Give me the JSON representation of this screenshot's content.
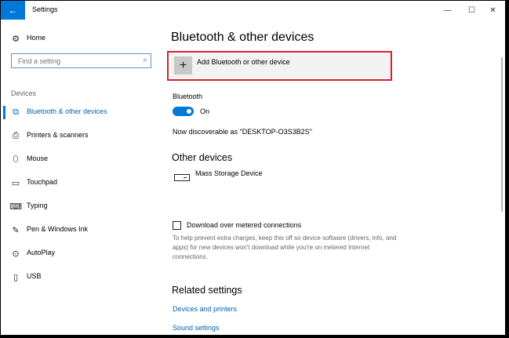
{
  "window": {
    "title": "Settings",
    "back_icon": "←",
    "minimize_icon": "—",
    "maximize_icon": "☐",
    "close_icon": "✕"
  },
  "sidebar": {
    "home": {
      "label": "Home",
      "icon": "⚙"
    },
    "search": {
      "placeholder": "Find a setting",
      "icon": "⌕"
    },
    "section_label": "Devices",
    "items": [
      {
        "label": "Bluetooth & other devices",
        "icon": "bluetooth-devices-icon",
        "glyph": "⧉",
        "active": true
      },
      {
        "label": "Printers & scanners",
        "icon": "printer-icon",
        "glyph": "⎙"
      },
      {
        "label": "Mouse",
        "icon": "mouse-icon",
        "glyph": "⬯"
      },
      {
        "label": "Touchpad",
        "icon": "touchpad-icon",
        "glyph": "▭"
      },
      {
        "label": "Typing",
        "icon": "keyboard-icon",
        "glyph": "⌨"
      },
      {
        "label": "Pen & Windows Ink",
        "icon": "pen-icon",
        "glyph": "✎"
      },
      {
        "label": "AutoPlay",
        "icon": "autoplay-icon",
        "glyph": "⊙"
      },
      {
        "label": "USB",
        "icon": "usb-icon",
        "glyph": "▯"
      }
    ]
  },
  "main": {
    "title": "Bluetooth & other devices",
    "add_button": {
      "label": "Add Bluetooth or other device",
      "icon": "+"
    },
    "bluetooth": {
      "label": "Bluetooth",
      "state": "On",
      "enabled": true
    },
    "discoverable": "Now discoverable as \"DESKTOP-O3S3B2S\"",
    "other_devices": {
      "heading": "Other devices",
      "devices": [
        {
          "name": "Mass Storage Device",
          "icon": "storage-device-icon"
        }
      ]
    },
    "metered": {
      "label": "Download over metered connections",
      "checked": false,
      "help": "To help prevent extra charges, keep this off so device software (drivers, info, and apps) for new devices won't download while you're on metered Internet connections."
    },
    "related": {
      "heading": "Related settings",
      "links": [
        "Devices and printers",
        "Sound settings"
      ]
    }
  },
  "colors": {
    "accent": "#0078d7",
    "link": "#0063b1",
    "highlight_border": "#e01c2a",
    "button_bg": "#f2f2f2"
  }
}
